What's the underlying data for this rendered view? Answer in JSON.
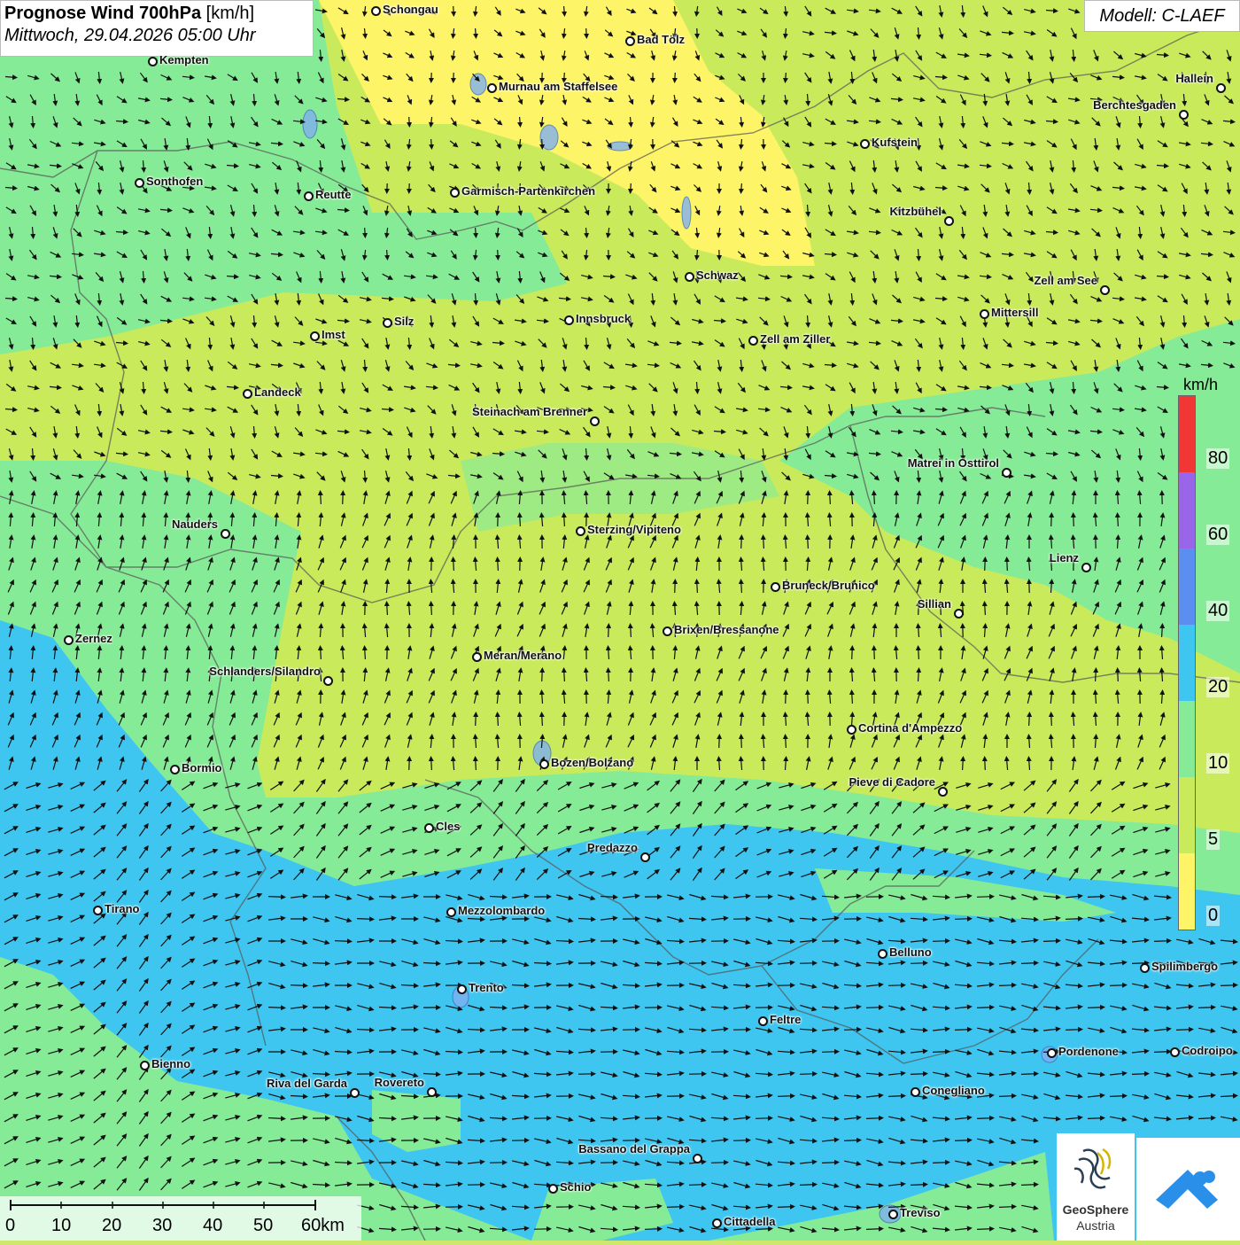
{
  "header": {
    "title_bold": "Prognose Wind 700hPa",
    "title_unit": "[km/h]",
    "subtitle": "Mittwoch, 29.04.2026 05:00 Uhr",
    "model": "Modell: C-LAEF"
  },
  "legend": {
    "unit": "km/h",
    "ticks": [
      "80",
      "60",
      "40",
      "20",
      "10",
      "5",
      "0"
    ],
    "colors": {
      "0-5": "#fef467",
      "5-10": "#c8ea5b",
      "10-20": "#86eb96",
      "20-40": "#3fc6f0",
      "40-60": "#5a8ef0",
      "60-80": "#9966ea",
      "80+": "#f23535"
    }
  },
  "scalebar": {
    "labels": [
      "0",
      "10",
      "20",
      "30",
      "40",
      "50",
      "60km"
    ]
  },
  "logos": {
    "geosphere_line1": "GeoSphere",
    "geosphere_line2": "Austria"
  },
  "cities": [
    {
      "name": "Schongau"
    },
    {
      "name": "Bad Tölz"
    },
    {
      "name": "Kempten"
    },
    {
      "name": "Murnau am Staffelsee"
    },
    {
      "name": "Hallein"
    },
    {
      "name": "Berchtesgaden"
    },
    {
      "name": "Kufstein"
    },
    {
      "name": "Sonthofen"
    },
    {
      "name": "Reutte"
    },
    {
      "name": "Garmisch-Partenkirchen"
    },
    {
      "name": "Kitzbühel"
    },
    {
      "name": "Schwaz"
    },
    {
      "name": "Zell am See"
    },
    {
      "name": "Innsbruck"
    },
    {
      "name": "Mittersill"
    },
    {
      "name": "Silz"
    },
    {
      "name": "Imst"
    },
    {
      "name": "Zell am Ziller"
    },
    {
      "name": "Landeck"
    },
    {
      "name": "Steinach am Brenner"
    },
    {
      "name": "Matrei in Osttirol"
    },
    {
      "name": "Nauders"
    },
    {
      "name": "Sterzing/Vipiteno"
    },
    {
      "name": "Lienz"
    },
    {
      "name": "Bruneck/Brunico"
    },
    {
      "name": "Sillian"
    },
    {
      "name": "Brixen/Bressanone"
    },
    {
      "name": "Zernez"
    },
    {
      "name": "Meran/Merano"
    },
    {
      "name": "Schlanders/Silandro"
    },
    {
      "name": "Cortina d'Ampezzo"
    },
    {
      "name": "Bozen/Bolzano"
    },
    {
      "name": "Bormio"
    },
    {
      "name": "Pieve di Cadore"
    },
    {
      "name": "Cles"
    },
    {
      "name": "Predazzo"
    },
    {
      "name": "Tirano"
    },
    {
      "name": "Mezzolombardo"
    },
    {
      "name": "Belluno"
    },
    {
      "name": "Spilimbergo"
    },
    {
      "name": "Trento"
    },
    {
      "name": "Feltre"
    },
    {
      "name": "Pordenone"
    },
    {
      "name": "Codroipo"
    },
    {
      "name": "Bienno"
    },
    {
      "name": "Riva del Garda"
    },
    {
      "name": "Rovereto"
    },
    {
      "name": "Conegliano"
    },
    {
      "name": "Bassano del Grappa"
    },
    {
      "name": "Schio"
    },
    {
      "name": "Treviso"
    },
    {
      "name": "Cittadella"
    }
  ]
}
